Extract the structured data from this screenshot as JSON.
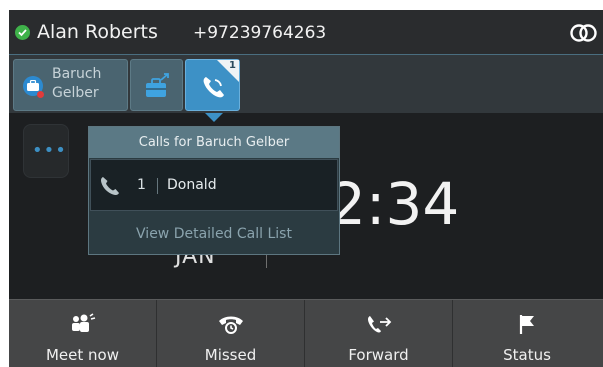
{
  "header": {
    "user_name": "Alan Roberts",
    "user_number": "+97239764263",
    "presence_color": "#3fb24a"
  },
  "tabs": {
    "baruch_line": {
      "label": "Baruch Gelber",
      "icon": "contact-avatar-icon"
    },
    "briefcase": {
      "icon": "briefcase-transfer-icon"
    },
    "calls": {
      "icon": "phone-icon",
      "badge": "1"
    }
  },
  "clock": {
    "time": "2:34",
    "date": "JAN"
  },
  "popup": {
    "title": "Calls for Baruch Gelber",
    "calls": [
      {
        "count": "1",
        "name": "Donald",
        "icon": "handset-icon"
      }
    ],
    "link": "View Detailed Call List"
  },
  "softkeys": [
    {
      "label": "Meet now",
      "icon": "meet-now-icon"
    },
    {
      "label": "Missed",
      "icon": "missed-call-icon"
    },
    {
      "label": "Forward",
      "icon": "forward-icon"
    },
    {
      "label": "Status",
      "icon": "flag-icon"
    }
  ],
  "colors": {
    "accent": "#3d91c6",
    "background": "#1d1f21",
    "popup_header": "#5b7985"
  }
}
